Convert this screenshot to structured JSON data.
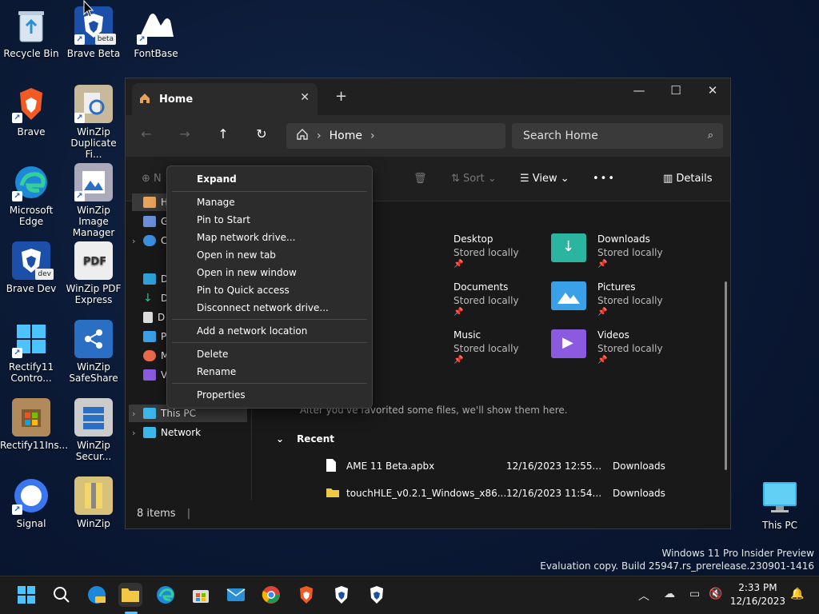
{
  "desktop": {
    "icons": [
      {
        "label": "Recycle Bin"
      },
      {
        "label": "Brave Beta",
        "badge": "beta"
      },
      {
        "label": "FontBase"
      },
      {
        "label": "Brave"
      },
      {
        "label": "WinZip Duplicate Fi..."
      },
      {
        "label": "Microsoft Edge"
      },
      {
        "label": "WinZip Image Manager"
      },
      {
        "label": "Brave Dev",
        "badge": "dev"
      },
      {
        "label": "WinZip PDF Express"
      },
      {
        "label": "Rectify11 Contro..."
      },
      {
        "label": "WinZip SafeShare"
      },
      {
        "label": "Rectify11Ins..."
      },
      {
        "label": "WinZip Secur..."
      },
      {
        "label": "Signal"
      },
      {
        "label": "WinZip"
      },
      {
        "label": "This PC"
      }
    ]
  },
  "window": {
    "tab_title": "Home",
    "breadcrumb": {
      "current": "Home"
    },
    "search": {
      "placeholder": "Search Home"
    },
    "toolbar": {
      "new_label": "N",
      "sort_label": "Sort",
      "view_label": "View",
      "details_label": "Details"
    },
    "sidebar": {
      "items": [
        {
          "label": "H"
        },
        {
          "label": "G"
        },
        {
          "label": "C"
        },
        {
          "label": "D"
        },
        {
          "label": "D"
        },
        {
          "label": "D"
        },
        {
          "label": "P"
        },
        {
          "label": "M"
        },
        {
          "label": "V"
        },
        {
          "label": "This PC"
        },
        {
          "label": "Network"
        }
      ]
    },
    "quick_access": [
      {
        "name": "Desktop",
        "sub": "Stored locally"
      },
      {
        "name": "Downloads",
        "sub": "Stored locally"
      },
      {
        "name": "Documents",
        "sub": "Stored locally"
      },
      {
        "name": "Pictures",
        "sub": "Stored locally"
      },
      {
        "name": "Music",
        "sub": "Stored locally"
      },
      {
        "name": "Videos",
        "sub": "Stored locally"
      }
    ],
    "favorites_hint": "After you've favorited some files, we'll show them here.",
    "recent": {
      "header": "Recent",
      "rows": [
        {
          "name": "AME 11 Beta.apbx",
          "date": "12/16/2023 12:55...",
          "location": "Downloads"
        },
        {
          "name": "touchHLE_v0.2.1_Windows_x86...",
          "date": "12/16/2023 11:54...",
          "location": "Downloads"
        }
      ]
    },
    "status": "8 items"
  },
  "context_menu": {
    "items": [
      "Expand",
      "Manage",
      "Pin to Start",
      "Map network drive...",
      "Open in new tab",
      "Open in new window",
      "Pin to Quick access",
      "Disconnect network drive...",
      "Add a network location",
      "Delete",
      "Rename",
      "Properties"
    ]
  },
  "watermark": {
    "line1": "Windows 11 Pro Insider Preview",
    "line2": "Evaluation copy. Build 25947.rs_prerelease.230901-1416"
  },
  "taskbar": {
    "time": "2:33 PM",
    "date": "12/16/2023"
  },
  "colors": {
    "accent": "#4cc2ff",
    "folder_teal": "#2bb5a0",
    "folder_blue": "#3aa0e8",
    "folder_purple": "#8a5be0"
  }
}
